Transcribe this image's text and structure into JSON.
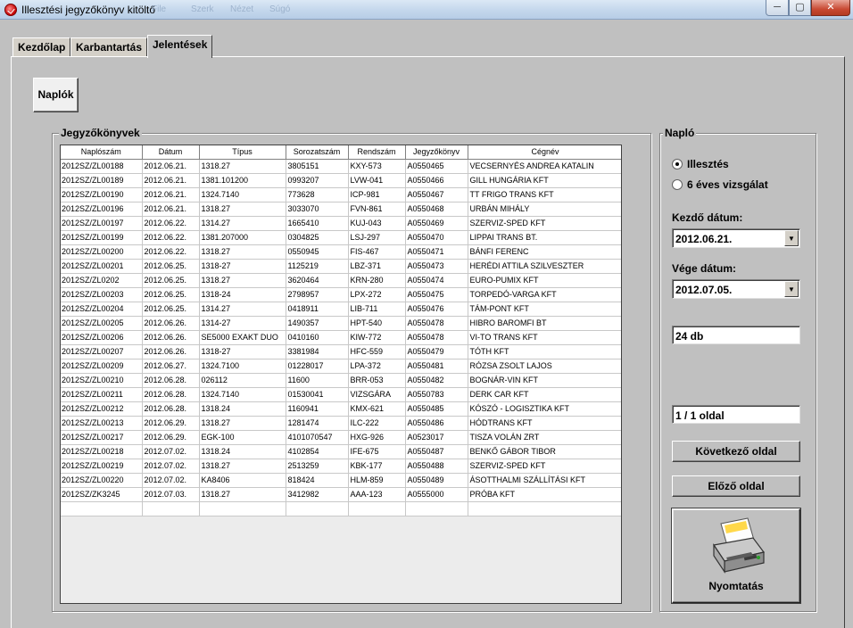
{
  "window": {
    "title": "Illesztési jegyzőkönyv kitöltő",
    "ghost_menu": [
      "File",
      "Szerk",
      "Nézet",
      "Súgó"
    ],
    "min_glyph": "─",
    "max_glyph": "▢",
    "close_glyph": "✕"
  },
  "tabs": [
    {
      "label": "Kezdőlap",
      "active": false
    },
    {
      "label": "Karbantartás",
      "active": false
    },
    {
      "label": "Jelentések",
      "active": true
    }
  ],
  "subtab": {
    "label": "Naplók"
  },
  "jegyzokonyvek": {
    "title": "Jegyzőkönyvek",
    "columns": [
      "Naplószám",
      "Dátum",
      "Típus",
      "Sorozatszám",
      "Rendszám",
      "Jegyzőkönyv",
      "Cégnév"
    ],
    "rows": [
      [
        "2012SZ/ZL00188",
        "2012.06.21.",
        "1318.27",
        "3805151",
        "KXY-573",
        "A0550465",
        "VECSERNYÉS ANDREA KATALIN"
      ],
      [
        "2012SZ/ZL00189",
        "2012.06.21.",
        "1381.101200",
        "0993207",
        "LVW-041",
        "A0550466",
        "GILL HUNGÁRIA KFT"
      ],
      [
        "2012SZ/ZL00190",
        "2012.06.21.",
        "1324.7140",
        "773628",
        "ICP-981",
        "A0550467",
        "TT FRIGO TRANS KFT"
      ],
      [
        "2012SZ/ZL00196",
        "2012.06.21.",
        "1318.27",
        "3033070",
        "FVN-861",
        "A0550468",
        "URBÁN MIHÁLY"
      ],
      [
        "2012SZ/ZL00197",
        "2012.06.22.",
        "1314.27",
        "1665410",
        "KUJ-043",
        "A0550469",
        "SZERVIZ-SPED KFT"
      ],
      [
        "2012SZ/ZL00199",
        "2012.06.22.",
        "1381.207000",
        "0304825",
        "LSJ-297",
        "A0550470",
        "LIPPAI TRANS BT."
      ],
      [
        "2012SZ/ZL00200",
        "2012.06.22.",
        "1318.27",
        "0550945",
        "FIS-467",
        "A0550471",
        "BÁNFI FERENC"
      ],
      [
        "2012SZ/ZL00201",
        "2012.06.25.",
        "1318-27",
        "1125219",
        "LBZ-371",
        "A0550473",
        "HERÉDI ATTILA SZILVESZTER"
      ],
      [
        "2012SZ/ZL0202",
        "2012.06.25.",
        "1318.27",
        "3620464",
        "KRN-280",
        "A0550474",
        "EURO-PUMIX KFT"
      ],
      [
        "2012SZ/ZL00203",
        "2012.06.25.",
        "1318-24",
        "2798957",
        "LPX-272",
        "A0550475",
        "TORPEDÓ-VARGA KFT"
      ],
      [
        "2012SZ/ZL00204",
        "2012.06.25.",
        "1314.27",
        "0418911",
        "LIB-711",
        "A0550476",
        "TÁM-PONT KFT"
      ],
      [
        "2012SZ/ZL00205",
        "2012.06.26.",
        "1314-27",
        "1490357",
        "HPT-540",
        "A0550478",
        "HIBRO BAROMFI BT"
      ],
      [
        "2012SZ/ZL00206",
        "2012.06.26.",
        "SE5000 EXAKT DUO",
        "0410160",
        "KIW-772",
        "A0550478",
        "VI-TO TRANS KFT"
      ],
      [
        "2012SZ/ZL00207",
        "2012.06.26.",
        "1318-27",
        "3381984",
        "HFC-559",
        "A0550479",
        "TÓTH KFT"
      ],
      [
        "2012SZ/ZL00209",
        "2012.06.27.",
        "1324.7100",
        "01228017",
        "LPA-372",
        "A0550481",
        "RÓZSA ZSOLT LAJOS"
      ],
      [
        "2012SZ/ZL00210",
        "2012.06.28.",
        "026112",
        "11600",
        "BRR-053",
        "A0550482",
        "BOGNÁR-VIN KFT"
      ],
      [
        "2012SZ/ZL00211",
        "2012.06.28.",
        "1324.7140",
        "01530041",
        "VIZSGÁRA",
        "A0550783",
        "DERK CAR KFT"
      ],
      [
        "2012SZ/ZL00212",
        "2012.06.28.",
        "1318.24",
        "1160941",
        "KMX-621",
        "A0550485",
        "KÓSZÓ - LOGISZTIKA KFT"
      ],
      [
        "2012SZ/ZL00213",
        "2012.06.29.",
        "1318.27",
        "1281474",
        "ILC-222",
        "A0550486",
        "HÓDTRANS KFT"
      ],
      [
        "2012SZ/ZL00217",
        "2012.06.29.",
        "EGK-100",
        "4101070547",
        "HXG-926",
        "A0523017",
        "TISZA VOLÁN ZRT"
      ],
      [
        "2012SZ/ZL00218",
        "2012.07.02.",
        "1318.24",
        "4102854",
        "IFE-675",
        "A0550487",
        "BENKŐ GÁBOR TIBOR"
      ],
      [
        "2012SZ/ZL00219",
        "2012.07.02.",
        "1318.27",
        "2513259",
        "KBK-177",
        "A0550488",
        "SZERVIZ-SPED KFT"
      ],
      [
        "2012SZ/ZL00220",
        "2012.07.02.",
        "KA8406",
        "818424",
        "HLM-859",
        "A0550489",
        "ÁSOTTHALMI SZÁLLÍTÁSI KFT"
      ],
      [
        "2012SZ/ZK3245",
        "2012.07.03.",
        "1318.27",
        "3412982",
        "AAA-123",
        "A0555000",
        "PRÓBA KFT"
      ],
      [
        "",
        "",
        "",
        "",
        "",
        "",
        ""
      ]
    ]
  },
  "naplo": {
    "title": "Napló",
    "radio_illesztes": "Illesztés",
    "radio_vizsgalat": "6 éves vizsgálat",
    "kezdo_label": "Kezdő dátum:",
    "kezdo_value": "2012.06.21.",
    "vege_label": "Vége dátum:",
    "vege_value": "2012.07.05.",
    "count": "24 db",
    "page": "1 / 1  oldal",
    "next_label": "Következő oldal",
    "prev_label": "Előző oldal",
    "print_label": "Nyomtatás"
  }
}
